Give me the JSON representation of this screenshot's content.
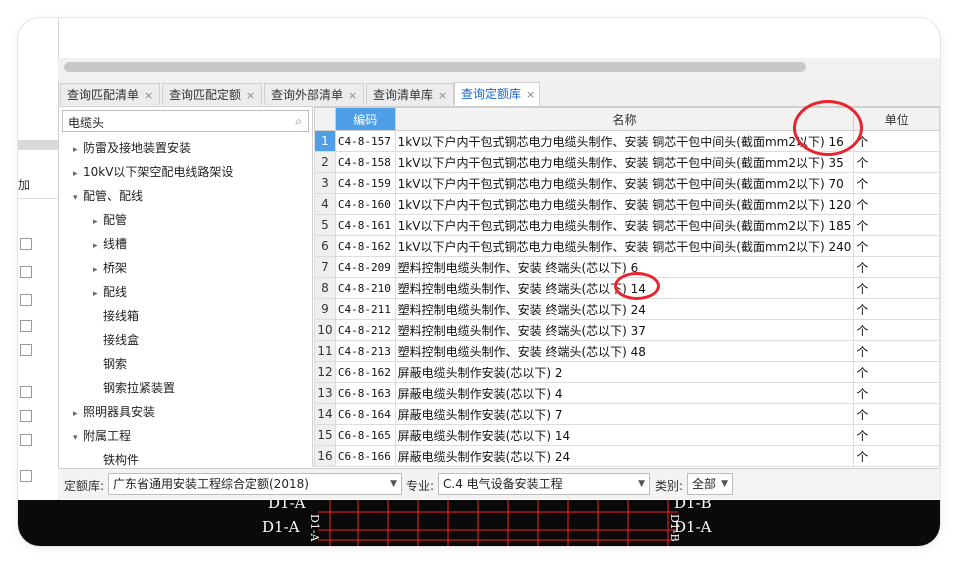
{
  "tabs": [
    {
      "label": "查询匹配清单",
      "active": false
    },
    {
      "label": "查询匹配定额",
      "active": false
    },
    {
      "label": "查询外部清单",
      "active": false
    },
    {
      "label": "查询清单库",
      "active": false
    },
    {
      "label": "查询定额库",
      "active": true
    }
  ],
  "tab_close_glyph": "×",
  "narrow_panel": {
    "add_label": "加"
  },
  "search": {
    "value": "电缆头",
    "icon": "search-icon"
  },
  "tree": [
    {
      "label": "防雷及接地装置安装",
      "level": 1,
      "arrow": "▸"
    },
    {
      "label": "10kV以下架空配电线路架设",
      "level": 1,
      "arrow": "▸"
    },
    {
      "label": "配管、配线",
      "level": 1,
      "arrow": "▾"
    },
    {
      "label": "配管",
      "level": 2,
      "arrow": "▸"
    },
    {
      "label": "线槽",
      "level": 2,
      "arrow": "▸"
    },
    {
      "label": "桥架",
      "level": 2,
      "arrow": "▸"
    },
    {
      "label": "配线",
      "level": 2,
      "arrow": "▸"
    },
    {
      "label": "接线箱",
      "level": 2,
      "arrow": ""
    },
    {
      "label": "接线盒",
      "level": 2,
      "arrow": ""
    },
    {
      "label": "钢索",
      "level": 2,
      "arrow": ""
    },
    {
      "label": "钢索拉紧装置",
      "level": 2,
      "arrow": ""
    },
    {
      "label": "照明器具安装",
      "level": 1,
      "arrow": "▸"
    },
    {
      "label": "附属工程",
      "level": 1,
      "arrow": "▾"
    },
    {
      "label": "铁构件",
      "level": 2,
      "arrow": ""
    }
  ],
  "table": {
    "headers": {
      "code": "编码",
      "name": "名称",
      "unit": "单位"
    },
    "rows": [
      {
        "no": "1",
        "code": "C4-8-157",
        "name": "1kV以下户内干包式铜芯电力电缆头制作、安装 铜芯干包中间头(截面mm2以下) 16",
        "unit": "个"
      },
      {
        "no": "2",
        "code": "C4-8-158",
        "name": "1kV以下户内干包式铜芯电力电缆头制作、安装 铜芯干包中间头(截面mm2以下) 35",
        "unit": "个"
      },
      {
        "no": "3",
        "code": "C4-8-159",
        "name": "1kV以下户内干包式铜芯电力电缆头制作、安装 铜芯干包中间头(截面mm2以下) 70",
        "unit": "个"
      },
      {
        "no": "4",
        "code": "C4-8-160",
        "name": "1kV以下户内干包式铜芯电力电缆头制作、安装 铜芯干包中间头(截面mm2以下) 120",
        "unit": "个"
      },
      {
        "no": "5",
        "code": "C4-8-161",
        "name": "1kV以下户内干包式铜芯电力电缆头制作、安装 铜芯干包中间头(截面mm2以下) 185",
        "unit": "个"
      },
      {
        "no": "6",
        "code": "C4-8-162",
        "name": "1kV以下户内干包式铜芯电力电缆头制作、安装 铜芯干包中间头(截面mm2以下) 240",
        "unit": "个"
      },
      {
        "no": "7",
        "code": "C4-8-209",
        "name": "塑料控制电缆头制作、安装 终端头(芯以下) 6",
        "unit": "个"
      },
      {
        "no": "8",
        "code": "C4-8-210",
        "name": "塑料控制电缆头制作、安装 终端头(芯以下) 14",
        "unit": "个"
      },
      {
        "no": "9",
        "code": "C4-8-211",
        "name": "塑料控制电缆头制作、安装 终端头(芯以下) 24",
        "unit": "个"
      },
      {
        "no": "10",
        "code": "C4-8-212",
        "name": "塑料控制电缆头制作、安装 终端头(芯以下) 37",
        "unit": "个"
      },
      {
        "no": "11",
        "code": "C4-8-213",
        "name": "塑料控制电缆头制作、安装 终端头(芯以下) 48",
        "unit": "个"
      },
      {
        "no": "12",
        "code": "C6-8-162",
        "name": "屏蔽电缆头制作安装(芯以下) 2",
        "unit": "个"
      },
      {
        "no": "13",
        "code": "C6-8-163",
        "name": "屏蔽电缆头制作安装(芯以下) 4",
        "unit": "个"
      },
      {
        "no": "14",
        "code": "C6-8-164",
        "name": "屏蔽电缆头制作安装(芯以下) 7",
        "unit": "个"
      },
      {
        "no": "15",
        "code": "C6-8-165",
        "name": "屏蔽电缆头制作安装(芯以下) 14",
        "unit": "个"
      },
      {
        "no": "16",
        "code": "C6-8-166",
        "name": "屏蔽电缆头制作安装(芯以下) 24",
        "unit": "个"
      }
    ]
  },
  "filter": {
    "library_label": "定额库:",
    "library_value": "广东省通用安装工程综合定额(2018)",
    "major_label": "专业:",
    "major_value": "C.4 电气设备安装工程",
    "category_label": "类别:",
    "category_value": "全部"
  },
  "cad_labels": [
    "D1-A",
    "D1-A",
    "D1-B",
    "D1-A",
    "D1-A",
    "D1-B"
  ],
  "colors": {
    "accent": "#4f9ee8",
    "annotation": "#e8242c",
    "cad_line": "#ff2020"
  }
}
